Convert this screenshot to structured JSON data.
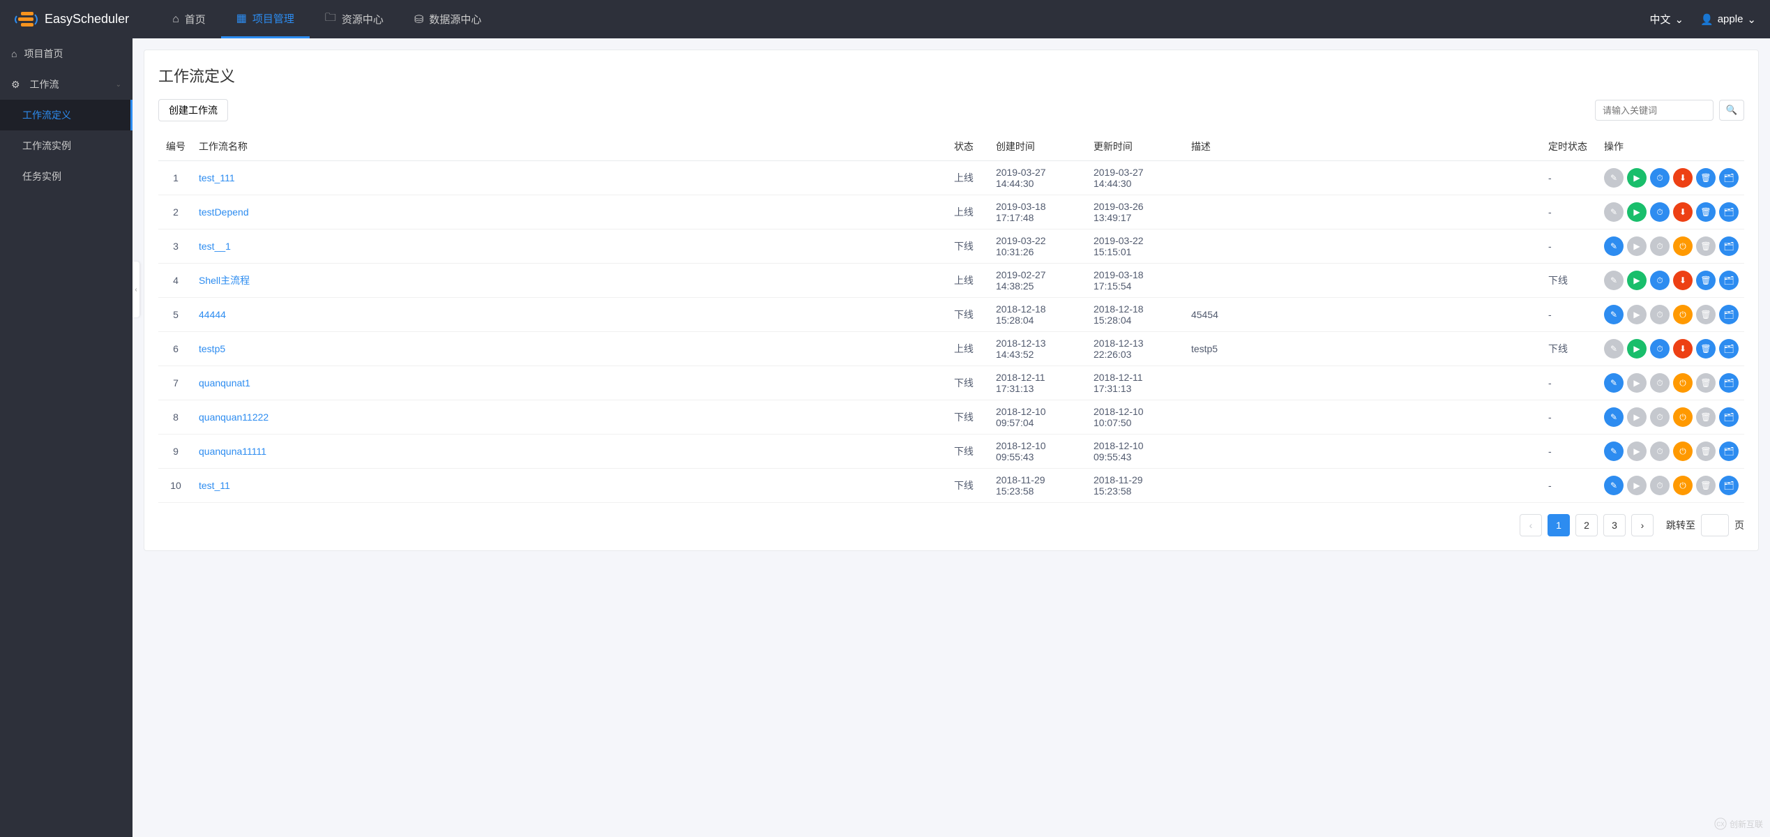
{
  "app": {
    "name": "EasyScheduler"
  },
  "nav": {
    "home": "首页",
    "project": "项目管理",
    "resource": "资源中心",
    "datasource": "数据源中心"
  },
  "header_right": {
    "lang": "中文",
    "user": "apple"
  },
  "sidebar": {
    "project_home": "项目首页",
    "workflow": "工作流",
    "workflow_def": "工作流定义",
    "workflow_instance": "工作流实例",
    "task_instance": "任务实例"
  },
  "page": {
    "title": "工作流定义",
    "create_btn": "创建工作流",
    "search_placeholder": "请输入关键词"
  },
  "columns": {
    "no": "编号",
    "name": "工作流名称",
    "status": "状态",
    "create_time": "创建时间",
    "update_time": "更新时间",
    "desc": "描述",
    "timing_status": "定时状态",
    "ops": "操作"
  },
  "status_labels": {
    "online": "上线",
    "offline": "下线"
  },
  "rows": [
    {
      "no": "1",
      "name": "test_111",
      "status": "上线",
      "create_time": "2019-03-27 14:44:30",
      "update_time": "2019-03-27 14:44:30",
      "desc": "",
      "timing_status": "-",
      "action_set": "online"
    },
    {
      "no": "2",
      "name": "testDepend",
      "status": "上线",
      "create_time": "2019-03-18 17:17:48",
      "update_time": "2019-03-26 13:49:17",
      "desc": "",
      "timing_status": "-",
      "action_set": "online"
    },
    {
      "no": "3",
      "name": "test__1",
      "status": "下线",
      "create_time": "2019-03-22 10:31:26",
      "update_time": "2019-03-22 15:15:01",
      "desc": "",
      "timing_status": "-",
      "action_set": "offline"
    },
    {
      "no": "4",
      "name": "Shell主流程",
      "status": "上线",
      "create_time": "2019-02-27 14:38:25",
      "update_time": "2019-03-18 17:15:54",
      "desc": "",
      "timing_status": "下线",
      "action_set": "online"
    },
    {
      "no": "5",
      "name": "44444",
      "status": "下线",
      "create_time": "2018-12-18 15:28:04",
      "update_time": "2018-12-18 15:28:04",
      "desc": "45454",
      "timing_status": "-",
      "action_set": "offline"
    },
    {
      "no": "6",
      "name": "testp5",
      "status": "上线",
      "create_time": "2018-12-13 14:43:52",
      "update_time": "2018-12-13 22:26:03",
      "desc": "testp5",
      "timing_status": "下线",
      "action_set": "online"
    },
    {
      "no": "7",
      "name": "quanqunat1",
      "status": "下线",
      "create_time": "2018-12-11 17:31:13",
      "update_time": "2018-12-11 17:31:13",
      "desc": "",
      "timing_status": "-",
      "action_set": "offline"
    },
    {
      "no": "8",
      "name": "quanquan11222",
      "status": "下线",
      "create_time": "2018-12-10 09:57:04",
      "update_time": "2018-12-10 10:07:50",
      "desc": "",
      "timing_status": "-",
      "action_set": "offline"
    },
    {
      "no": "9",
      "name": "quanquna11111",
      "status": "下线",
      "create_time": "2018-12-10 09:55:43",
      "update_time": "2018-12-10 09:55:43",
      "desc": "",
      "timing_status": "-",
      "action_set": "offline"
    },
    {
      "no": "10",
      "name": "test_11",
      "status": "下线",
      "create_time": "2018-11-29 15:23:58",
      "update_time": "2018-11-29 15:23:58",
      "desc": "",
      "timing_status": "-",
      "action_set": "offline"
    }
  ],
  "pagination": {
    "pages": [
      "1",
      "2",
      "3"
    ],
    "current": "1",
    "jump_label": "跳转至",
    "page_suffix": "页"
  },
  "watermark": "创新互联",
  "action_icons": {
    "edit": "✎",
    "run": "▶",
    "timing": "⏱",
    "online": "⬆",
    "offline": "⬇",
    "delete": "🗑",
    "tree": "🗂",
    "power": "⏻"
  }
}
